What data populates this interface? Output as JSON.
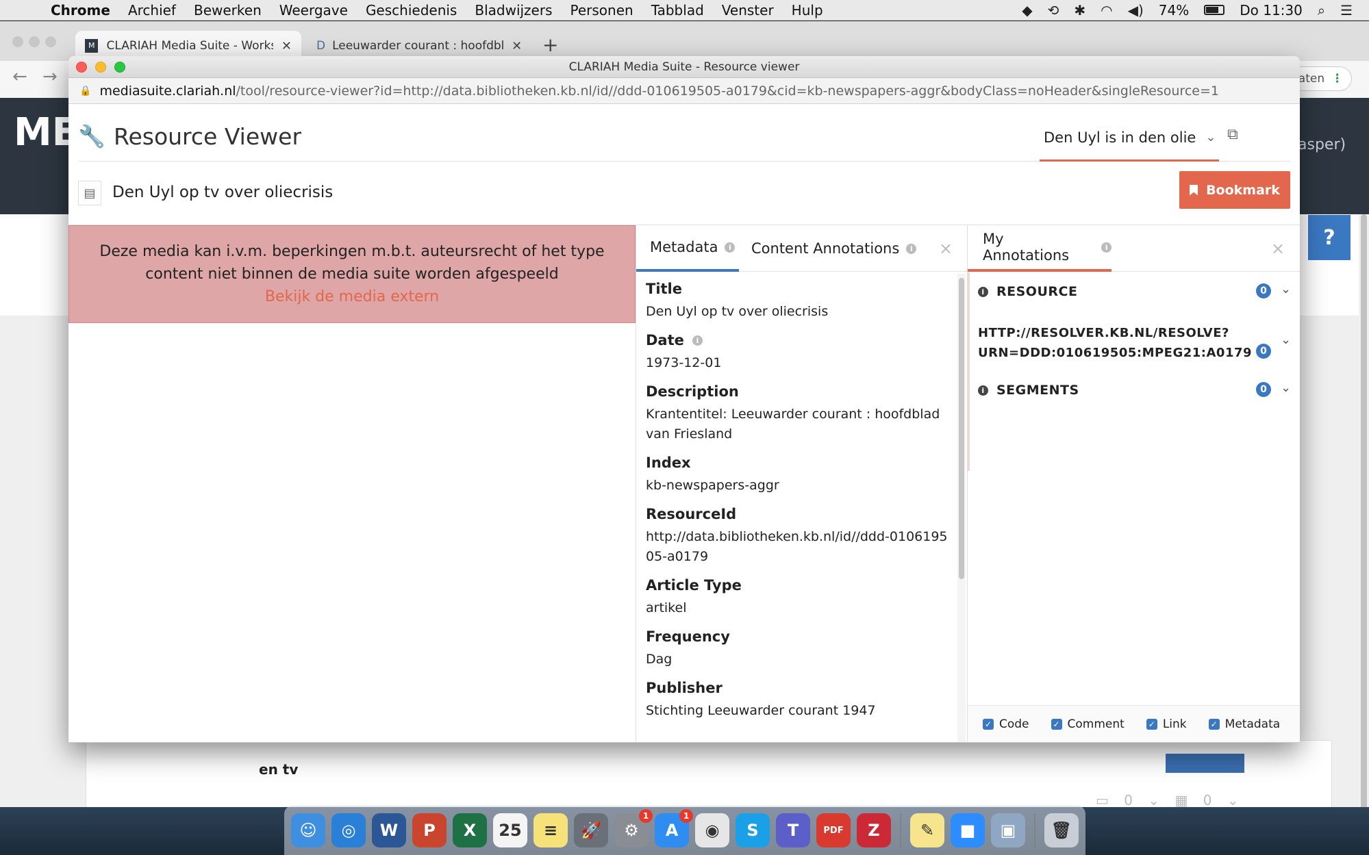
{
  "menubar": {
    "app_name": "Chrome",
    "menus": [
      "Archief",
      "Bewerken",
      "Weergave",
      "Geschiedenis",
      "Bladwijzers",
      "Personen",
      "Tabblad",
      "Venster",
      "Hulp"
    ],
    "battery": "74%",
    "clock": "Do 11:30",
    "battery_level": 0.74
  },
  "browser": {
    "tabs": [
      {
        "label": "CLARIAH Media Suite - Worksp",
        "favicon": "M"
      },
      {
        "label": "Leeuwarder courant : hoofdbla",
        "favicon": "D"
      }
    ],
    "new_tab": "+",
    "update_label": "daten",
    "update_menu": "⋮",
    "back": "←",
    "forward": "→"
  },
  "background_page": {
    "logo": "ME",
    "user": "asper)",
    "help": "?",
    "card_text": "en tv",
    "card_counts": [
      "0",
      "0"
    ]
  },
  "popup": {
    "window_title": "CLARIAH Media Suite - Resource viewer",
    "url_domain": "mediasuite.clariah.nl",
    "url_path": "/tool/resource-viewer?id=http://data.bibliotheken.kb.nl/id//ddd-010619505-a0179&cid=kb-newspapers-aggr&bodyClass=noHeader&singleResource=1"
  },
  "viewer": {
    "title": "Resource Viewer",
    "project_select": "Den Uyl is in den olie",
    "resource_title": "Den Uyl op tv over oliecrisis",
    "bookmark_label": "Bookmark",
    "media_warning_line1": "Deze media kan i.v.m. beperkingen m.b.t. auteursrecht of het type",
    "media_warning_line2": "content niet binnen de media suite worden afgespeeld",
    "media_link": "Bekijk de media extern"
  },
  "metadata_panel": {
    "tabs": [
      {
        "label": "Metadata",
        "active": true
      },
      {
        "label": "Content Annotations",
        "active": false
      }
    ],
    "close": "×",
    "fields": [
      {
        "label": "Title",
        "value": "Den Uyl op tv over oliecrisis"
      },
      {
        "label": "Date",
        "value": "1973-12-01",
        "info": true
      },
      {
        "label": "Description",
        "value": "Krantentitel: Leeuwarder courant : hoofdblad van Friesland"
      },
      {
        "label": "Index",
        "value": "kb-newspapers-aggr"
      },
      {
        "label": "ResourceId",
        "value": "http://data.bibliotheken.kb.nl/id//ddd-010619505-a0179"
      },
      {
        "label": "Article Type",
        "value": "artikel"
      },
      {
        "label": "Frequency",
        "value": "Dag"
      },
      {
        "label": "Publisher",
        "value": "Stichting Leeuwarder courant 1947"
      }
    ]
  },
  "annotations_panel": {
    "tab_label": "My Annotations",
    "close": "×",
    "sections": [
      {
        "label": "RESOURCE",
        "count": "0"
      },
      {
        "label": "HTTP://RESOLVER.KB.NL/RESOLVE?URN=DDD:010619505:MPEG21:A0179",
        "line1": "HTTP://RESOLVER.KB.NL/RESOLVE?",
        "line2": "URN=DDD:010619505:MPEG21:A0179",
        "count": "0"
      },
      {
        "label": "SEGMENTS",
        "count": "0"
      }
    ],
    "filters": [
      {
        "label": "Code",
        "checked": true
      },
      {
        "label": "Comment",
        "checked": true
      },
      {
        "label": "Link",
        "checked": true
      },
      {
        "label": "Metadata",
        "checked": true
      }
    ]
  },
  "dock": {
    "apps": [
      {
        "name": "finder",
        "color": "#3f8fe0",
        "glyph": "☺"
      },
      {
        "name": "safari",
        "color": "#2a7fd6",
        "glyph": "◎"
      },
      {
        "name": "word",
        "color": "#2b5797",
        "glyph": "W"
      },
      {
        "name": "powerpoint",
        "color": "#c9452e",
        "glyph": "P"
      },
      {
        "name": "excel",
        "color": "#1e7145",
        "glyph": "X"
      },
      {
        "name": "calendar",
        "color": "#f4f4f4",
        "glyph": "25",
        "dark": true
      },
      {
        "name": "notes",
        "color": "#f7e27a",
        "glyph": "≡",
        "dark": true
      },
      {
        "name": "launchpad",
        "color": "#6b6f78",
        "glyph": "🚀"
      },
      {
        "name": "system-preferences",
        "color": "#8a8d93",
        "glyph": "⚙",
        "badge": "1"
      },
      {
        "name": "app-store",
        "color": "#2f8cf0",
        "glyph": "A",
        "badge": "1"
      },
      {
        "name": "chrome",
        "color": "#e6e6e6",
        "glyph": "◉",
        "dark": true
      },
      {
        "name": "skype",
        "color": "#1ba0e8",
        "glyph": "S"
      },
      {
        "name": "teams",
        "color": "#5b5fc7",
        "glyph": "T"
      },
      {
        "name": "pdf",
        "color": "#d93a2f",
        "glyph": "PDF"
      },
      {
        "name": "zotero",
        "color": "#cc2936",
        "glyph": "Z"
      },
      {
        "name": "stickies",
        "color": "#f6e58d",
        "glyph": "✎",
        "dark": true
      },
      {
        "name": "zoom",
        "color": "#2d8cff",
        "glyph": "■"
      },
      {
        "name": "preview",
        "color": "#8fa7c2",
        "glyph": "▣"
      },
      {
        "name": "trash",
        "color": "#c9ced6",
        "glyph": "🗑",
        "dark": true
      }
    ]
  }
}
